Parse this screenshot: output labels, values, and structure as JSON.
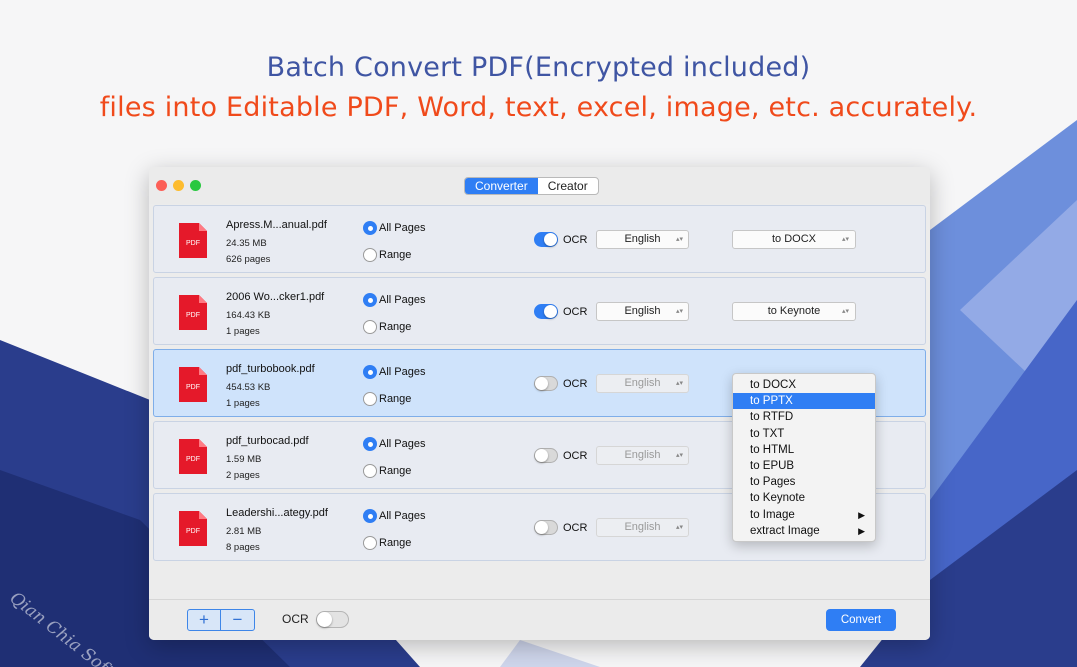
{
  "headline": "Batch Convert PDF(Encrypted included)",
  "subline": "files into Editable PDF, Word, text, excel, image, etc. accurately.",
  "watermark": "Qian Chia Soft",
  "colors": {
    "accent": "#2f7ef4",
    "headline": "#3f55a3",
    "subline": "#f04a1b",
    "pdf_icon": "#e5192a"
  },
  "titlebar": {
    "tabs": [
      {
        "label": "Converter",
        "active": true
      },
      {
        "label": "Creator",
        "active": false
      }
    ]
  },
  "files": [
    {
      "name": "Apress.M...anual.pdf",
      "size": "24.35 MB",
      "pages": "626 pages",
      "range_mode": "all",
      "ocr": true,
      "language": "English",
      "format": "to DOCX",
      "selected": false
    },
    {
      "name": "2006 Wo...cker1.pdf",
      "size": "164.43 KB",
      "pages": "1 pages",
      "range_mode": "all",
      "ocr": true,
      "language": "English",
      "format": "to Keynote",
      "selected": false
    },
    {
      "name": "pdf_turbobook.pdf",
      "size": "454.53 KB",
      "pages": "1 pages",
      "range_mode": "all",
      "ocr": false,
      "language": "English",
      "format": "",
      "selected": true
    },
    {
      "name": "pdf_turbocad.pdf",
      "size": "1.59 MB",
      "pages": "2 pages",
      "range_mode": "all",
      "ocr": false,
      "language": "English",
      "format": "",
      "selected": false
    },
    {
      "name": "Leadershi...ategy.pdf",
      "size": "2.81 MB",
      "pages": "8 pages",
      "range_mode": "all",
      "ocr": false,
      "language": "English",
      "format": "",
      "selected": false
    }
  ],
  "labels": {
    "all_pages": "All Pages",
    "range": "Range",
    "ocr": "OCR",
    "pdf_badge": "PDF"
  },
  "format_menu": {
    "highlighted": "to PPTX",
    "items": [
      {
        "label": "to DOCX",
        "submenu": false
      },
      {
        "label": "to PPTX",
        "submenu": false
      },
      {
        "label": "to RTFD",
        "submenu": false
      },
      {
        "label": "to TXT",
        "submenu": false
      },
      {
        "label": "to HTML",
        "submenu": false
      },
      {
        "label": "to EPUB",
        "submenu": false
      },
      {
        "label": "to Pages",
        "submenu": false
      },
      {
        "label": "to Keynote",
        "submenu": false
      },
      {
        "label": "to Image",
        "submenu": true
      },
      {
        "label": "extract Image",
        "submenu": true
      }
    ]
  },
  "bottom": {
    "plus": "+",
    "minus": "−",
    "ocr_label": "OCR",
    "ocr_on": false,
    "convert": "Convert"
  }
}
